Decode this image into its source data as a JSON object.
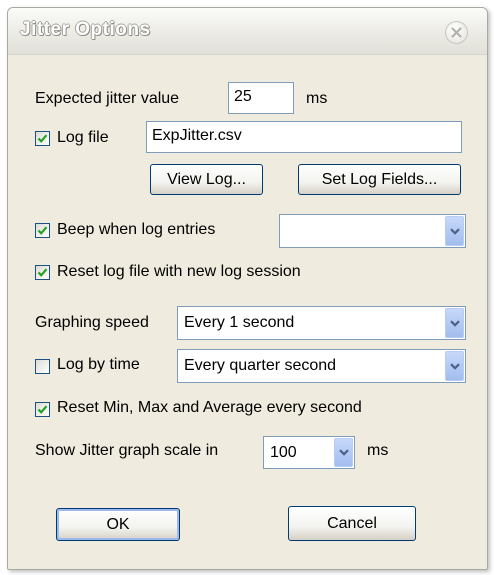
{
  "window": {
    "title": "Jitter Options"
  },
  "expected_jitter": {
    "label": "Expected jitter value",
    "value": "25",
    "unit": "ms"
  },
  "log_file": {
    "label": "Log file",
    "checked": true,
    "value": "ExpJitter.csv"
  },
  "buttons": {
    "view_log": "View Log...",
    "set_log_fields": "Set Log Fields...",
    "ok": "OK",
    "cancel": "Cancel"
  },
  "beep": {
    "label": "Beep when log entries",
    "checked": true,
    "value": ""
  },
  "reset_log": {
    "label": "Reset log file with new log session",
    "checked": true
  },
  "graphing_speed": {
    "label": "Graphing speed",
    "value": "Every 1 second"
  },
  "log_by_time": {
    "label": "Log by time",
    "checked": false,
    "value": "Every quarter second"
  },
  "reset_stats": {
    "label": "Reset Min, Max and Average every second",
    "checked": true
  },
  "graph_scale": {
    "label": "Show Jitter graph scale in",
    "value": "100",
    "unit": "ms"
  },
  "icons": {
    "check": "checkmark-icon",
    "dropdown": "chevron-down-icon",
    "close": "close-icon"
  },
  "colors": {
    "window_bg": "#efebde",
    "check": "#21a121",
    "combo_arrow": "#4d6185",
    "input_border": "#7f9db9"
  }
}
